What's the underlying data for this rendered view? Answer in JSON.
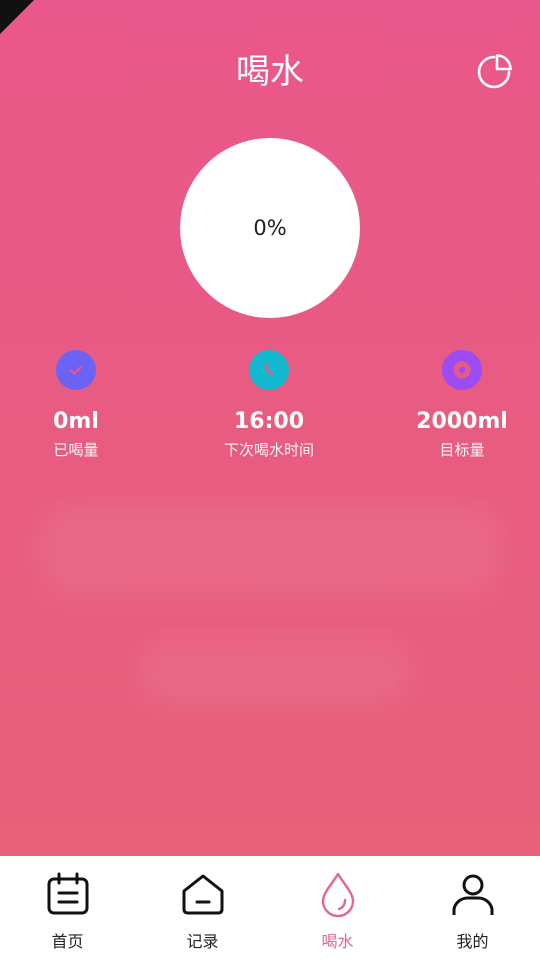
{
  "header": {
    "title": "喝水"
  },
  "progress": {
    "text": "0%",
    "fraction": 0
  },
  "stats": [
    {
      "value": "0ml",
      "label": "已喝量",
      "icon": "check-icon",
      "color": "#6a63f5"
    },
    {
      "value": "16:00",
      "label": "下次喝水时间",
      "icon": "clock-icon",
      "color": "#12b7d0"
    },
    {
      "value": "2000ml",
      "label": "目标量",
      "icon": "target-icon",
      "color": "#9c4cf2"
    }
  ],
  "tabs": [
    {
      "label": "首页",
      "icon": "calendar-icon"
    },
    {
      "label": "记录",
      "icon": "house-icon"
    },
    {
      "label": "喝水",
      "icon": "water-drop-icon",
      "active": true
    },
    {
      "label": "我的",
      "icon": "user-icon"
    }
  ],
  "colors": {
    "background": "#e85a86",
    "active_tab": "#e4678c"
  }
}
